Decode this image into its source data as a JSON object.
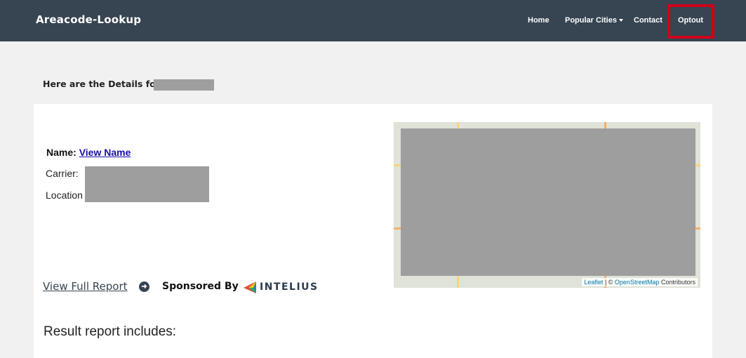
{
  "navbar": {
    "brand": "Areacode-Lookup",
    "items": [
      {
        "label": "Home"
      },
      {
        "label": "Popular Cities"
      },
      {
        "label": "Contact"
      },
      {
        "label": "Optout"
      }
    ],
    "highlight_color": "#d0021b",
    "background_color": "#374451"
  },
  "details": {
    "heading": "Here are the Details for:"
  },
  "info": {
    "name_label": "Name:",
    "name_link": "View Name",
    "carrier_label": "Carrier:",
    "location_label": "Location"
  },
  "report": {
    "link_text": "View Full Report",
    "link_icon": "arrow-circle-right-icon",
    "sponsored_text": "Sponsored By",
    "sponsor_name": "INTELIUS"
  },
  "map": {
    "attribution_leaflet": "Leaflet",
    "attribution_sep": " | © ",
    "attribution_osm": "OpenStreetMap",
    "attribution_suffix": " Contributors"
  },
  "results": {
    "heading": "Result report includes:"
  }
}
